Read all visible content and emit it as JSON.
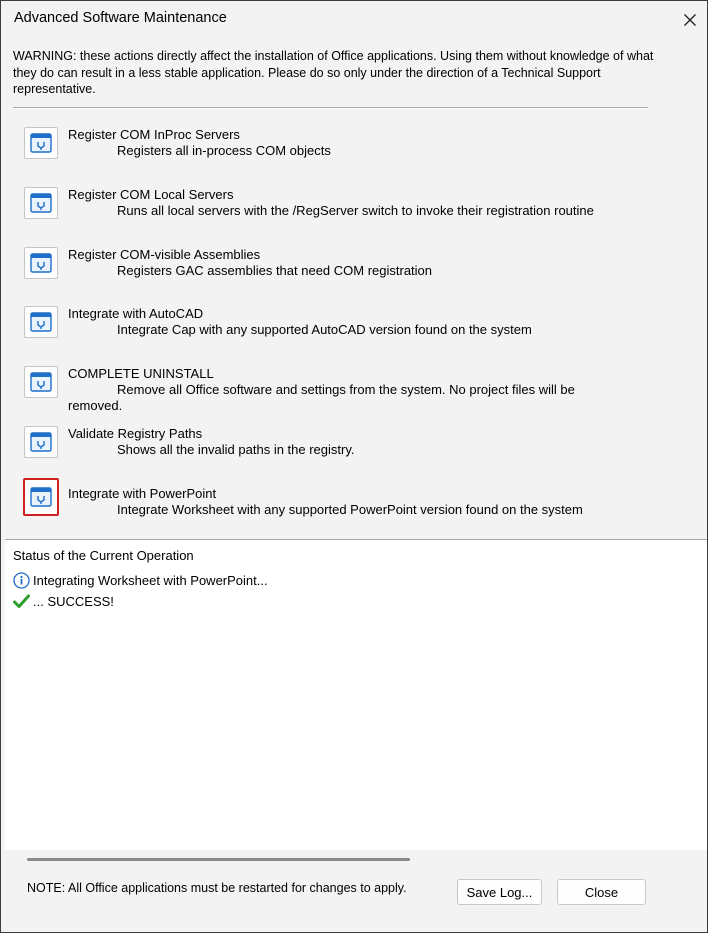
{
  "window": {
    "title": "Advanced Software Maintenance",
    "close_glyph": "✕"
  },
  "warning_text": "WARNING: these actions directly affect the installation of Office applications.  Using them without knowledge of what they do can result in a less stable application.  Please do so only under the direction of a Technical Support representative.",
  "actions": [
    {
      "title": "Register COM InProc Servers",
      "description": "Registers all in-process COM objects",
      "icon": "wrench-window-icon",
      "selected": false
    },
    {
      "title": "Register COM Local Servers",
      "description": "Runs all local servers with the /RegServer switch to invoke their registration routine",
      "icon": "wrench-window-icon",
      "selected": false
    },
    {
      "title": "Register COM-visible Assemblies",
      "description": "Registers GAC assemblies that need COM registration",
      "icon": "wrench-window-icon",
      "selected": false
    },
    {
      "title": "Integrate with AutoCAD",
      "description": "Integrate Cap with any supported AutoCAD version found on the system",
      "icon": "wrench-window-icon",
      "selected": false
    },
    {
      "title": "COMPLETE UNINSTALL",
      "description": "Remove all Office software and settings from the system. No project files will be removed.",
      "icon": "wrench-window-icon",
      "selected": false
    },
    {
      "title": "Validate Registry Paths",
      "description": "Shows all the invalid paths in the registry.",
      "icon": "wrench-window-icon",
      "selected": false
    },
    {
      "title": "Integrate with PowerPoint",
      "description": "Integrate Worksheet with any supported PowerPoint version found on the system",
      "icon": "wrench-window-icon",
      "selected": true
    }
  ],
  "status": {
    "title": "Status of the Current Operation",
    "lines": [
      {
        "icon": "info-icon",
        "text": "Integrating Worksheet with PowerPoint..."
      },
      {
        "icon": "checkmark-icon",
        "text": "... SUCCESS!"
      }
    ]
  },
  "footer": {
    "note": "NOTE: All Office applications must be restarted for changes to apply.",
    "save_log_label": "Save Log...",
    "close_label": "Close"
  },
  "colors": {
    "selected_border": "#d12020",
    "icon_blue": "#1e6fc8",
    "success_green": "#2a9d2a"
  }
}
